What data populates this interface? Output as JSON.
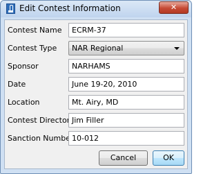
{
  "window": {
    "title": "Edit Contest Information",
    "close_symbol": "✕",
    "app_icon": "rocket-icon"
  },
  "form": {
    "contest_name": {
      "label": "Contest Name",
      "value": "ECRM-37"
    },
    "contest_type": {
      "label": "Contest Type",
      "value": "NAR Regional"
    },
    "sponsor": {
      "label": "Sponsor",
      "value": "NARHAMS"
    },
    "date": {
      "label": "Date",
      "value": "June 19-20, 2010"
    },
    "location": {
      "label": "Location",
      "value": "Mt. Airy, MD"
    },
    "contest_director": {
      "label": "Contest Director",
      "value": "Jim Filler"
    },
    "sanction_number": {
      "label": "Sanction Number",
      "value": "10-012"
    }
  },
  "buttons": {
    "cancel": "Cancel",
    "ok": "OK"
  }
}
